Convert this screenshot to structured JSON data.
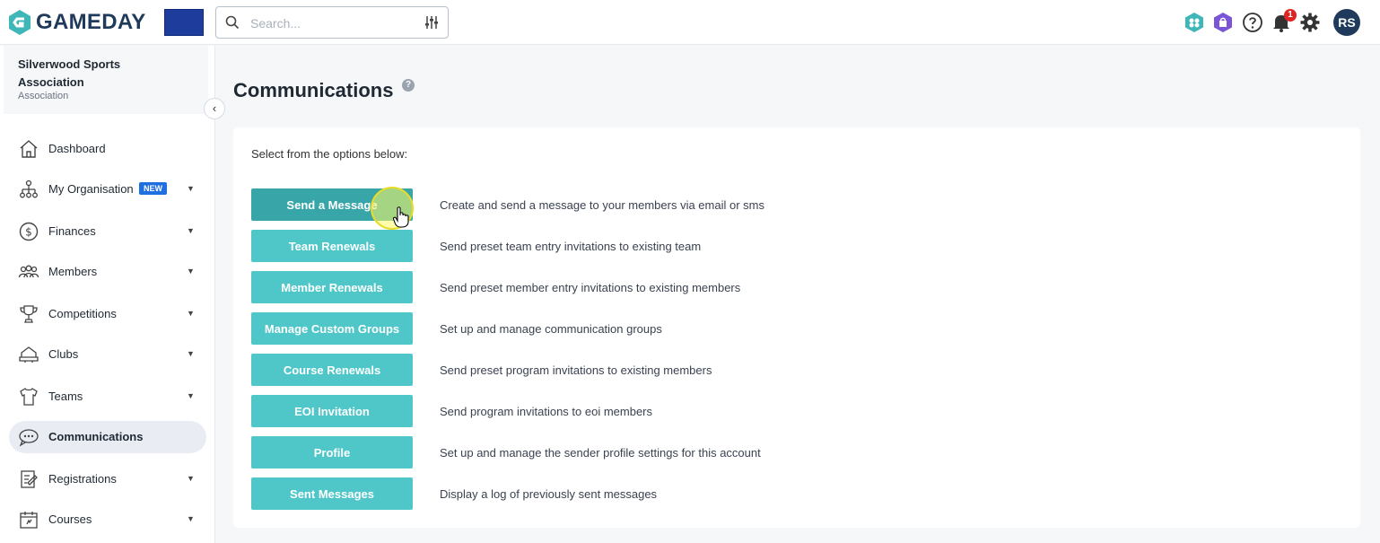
{
  "brand": {
    "name": "GAMEDAY"
  },
  "search": {
    "placeholder": "Search..."
  },
  "header": {
    "notification_count": "1",
    "avatar_initials": "RS"
  },
  "sidebar": {
    "org_name": "Silverwood Sports Association",
    "org_type": "Association",
    "items": [
      {
        "label": "Dashboard",
        "icon": "home-icon",
        "has_caret": false
      },
      {
        "label": "My Organisation",
        "icon": "org-chart-icon",
        "has_caret": true,
        "badge": "NEW"
      },
      {
        "label": "Finances",
        "icon": "dollar-icon",
        "has_caret": true
      },
      {
        "label": "Members",
        "icon": "members-icon",
        "has_caret": true
      },
      {
        "label": "Competitions",
        "icon": "trophy-icon",
        "has_caret": true
      },
      {
        "label": "Clubs",
        "icon": "clubs-icon",
        "has_caret": true
      },
      {
        "label": "Teams",
        "icon": "jersey-icon",
        "has_caret": true
      },
      {
        "label": "Communications",
        "icon": "chat-icon",
        "has_caret": false,
        "active": true
      },
      {
        "label": "Registrations",
        "icon": "registration-icon",
        "has_caret": true
      },
      {
        "label": "Courses",
        "icon": "calendar-icon",
        "has_caret": true
      }
    ]
  },
  "main": {
    "title": "Communications",
    "intro": "Select from the options below:",
    "options": [
      {
        "label": "Send a Message",
        "description": "Create and send a message to your members via email or sms"
      },
      {
        "label": "Team Renewals",
        "description": "Send preset team entry invitations to existing team"
      },
      {
        "label": "Member Renewals",
        "description": "Send preset member entry invitations to existing members"
      },
      {
        "label": "Manage Custom Groups",
        "description": "Set up and manage communication groups"
      },
      {
        "label": "Course Renewals",
        "description": "Send preset program invitations to existing members"
      },
      {
        "label": "EOI Invitation",
        "description": "Send program invitations to eoi members"
      },
      {
        "label": "Profile",
        "description": "Set up and manage the sender profile settings for this account"
      },
      {
        "label": "Sent Messages",
        "description": "Display a log of previously sent messages"
      }
    ]
  },
  "colors": {
    "accent": "#4fc7c9",
    "accent_hover": "#38a6a8",
    "brand_navy": "#1f3a5b",
    "badge_red": "#e02424",
    "new_badge": "#1f6fe0"
  }
}
